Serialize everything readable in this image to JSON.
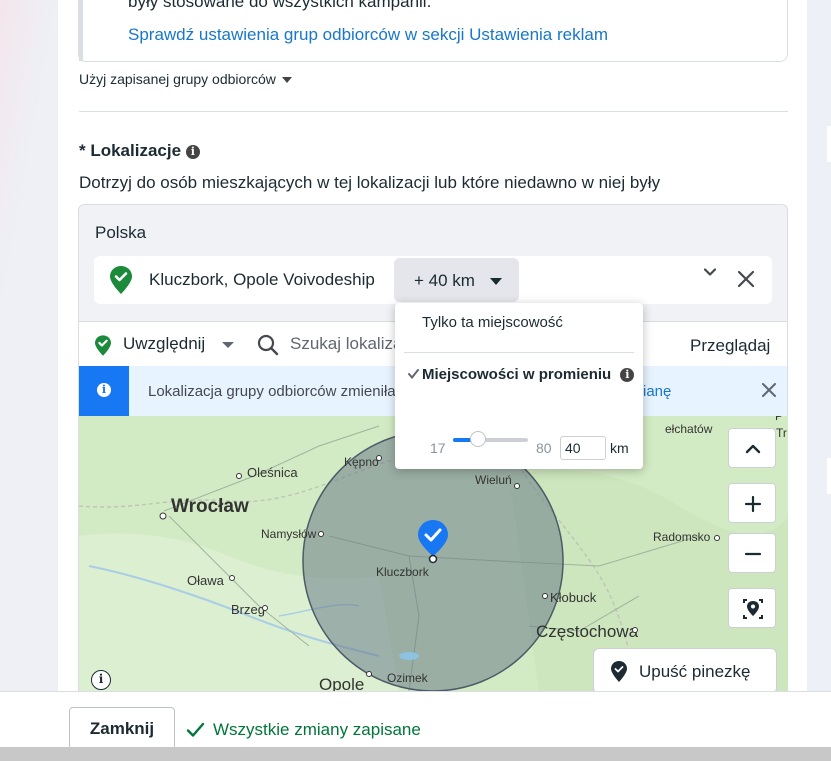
{
  "audience_card": {
    "clipped_text": "były stosowane do wszystkich kampanii.",
    "link": "Sprawdź ustawienia grup odbiorców w sekcji Ustawienia reklam"
  },
  "saved_audience": {
    "label": "Użyj zapisanej grupy odbiorców"
  },
  "locations": {
    "title": "* Lokalizacje",
    "description": "Dotrzyj do osób mieszkających w tej lokalizacji lub które niedawno w niej były",
    "country": "Polska",
    "selected": {
      "name": "Kluczbork, Opole Voivodeship",
      "radius_label": "+ 40 km"
    },
    "include_label": "Uwzględnij",
    "search_placeholder": "Szukaj lokalizacji",
    "browse_label": "Przeglądaj",
    "banner": {
      "text": "Lokalizacja grupy odbiorców zmieniła",
      "link": "ianę"
    }
  },
  "radius_popup": {
    "option_city_only": "Tylko ta miejscowość",
    "option_radius": "Miejscowości w promieniu",
    "slider_min": "17",
    "slider_max": "80",
    "value": "40",
    "fraction": 0.33,
    "unit": "km"
  },
  "map": {
    "cities": {
      "wroclaw": "Wrocław",
      "olesnica": "Oleśnica",
      "namyslow": "Namysłów",
      "olawa": "Oława",
      "brzeg": "Brzeg",
      "kepno": "Kępno",
      "wielun": "Wieluń",
      "kluczbork": "Kluczbork",
      "klobuck": "Kłobuck",
      "czestochowa": "Częstochowa",
      "opole": "Opole",
      "ozimek": "Ozimek",
      "radomsko": "Radomsko",
      "belchatow": "ełchatów",
      "p": "P",
      "tr": "Tr"
    },
    "drop_pin_label": "Upuść pinezkę",
    "info_glyph": "i"
  },
  "footer": {
    "close_label": "Zamknij",
    "status": "Wszystkie zmiany zapisane"
  },
  "colors": {
    "accent": "#1877f2",
    "link": "#1877c9",
    "success": "#00763a",
    "radius_fill": "#6b7b8a"
  },
  "icons": [
    "chevron-down-icon",
    "close-icon",
    "search-icon",
    "location-pin-icon",
    "info-icon",
    "check-icon",
    "locate-icon",
    "zoom-in-icon",
    "zoom-out-icon",
    "chevron-up-icon"
  ]
}
